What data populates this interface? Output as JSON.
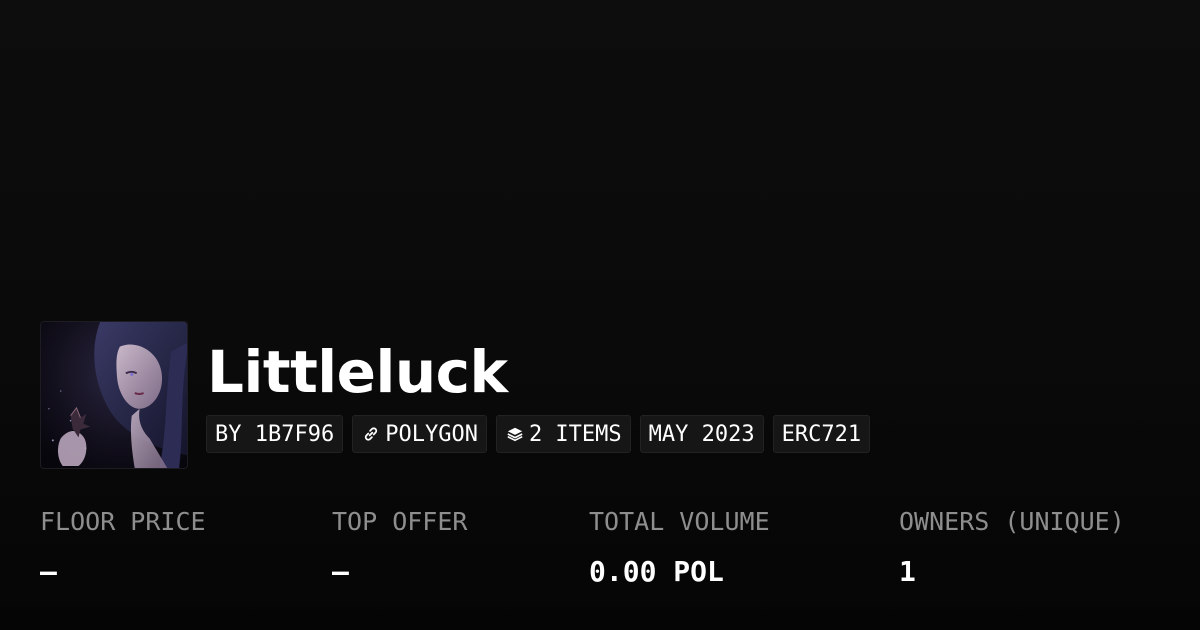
{
  "collection": {
    "title": "Littleluck",
    "avatar_icon": "collection-avatar-image"
  },
  "chips": {
    "creator": "BY 1B7F96",
    "chain": "POLYGON",
    "chain_icon": "link-icon",
    "items": "2 ITEMS",
    "items_icon": "layers-icon",
    "date": "MAY 2023",
    "standard": "ERC721"
  },
  "stats": {
    "floor_price": {
      "label": "FLOOR PRICE",
      "value": "–"
    },
    "top_offer": {
      "label": "TOP OFFER",
      "value": "–"
    },
    "total_volume": {
      "label": "TOTAL VOLUME",
      "value": "0.00 POL"
    },
    "owners": {
      "label": "OWNERS (UNIQUE)",
      "value": "1"
    }
  },
  "colors": {
    "background": "#0a0a0a",
    "chip_background": "#161616",
    "label": "#8e8e8e",
    "text": "#ffffff"
  }
}
